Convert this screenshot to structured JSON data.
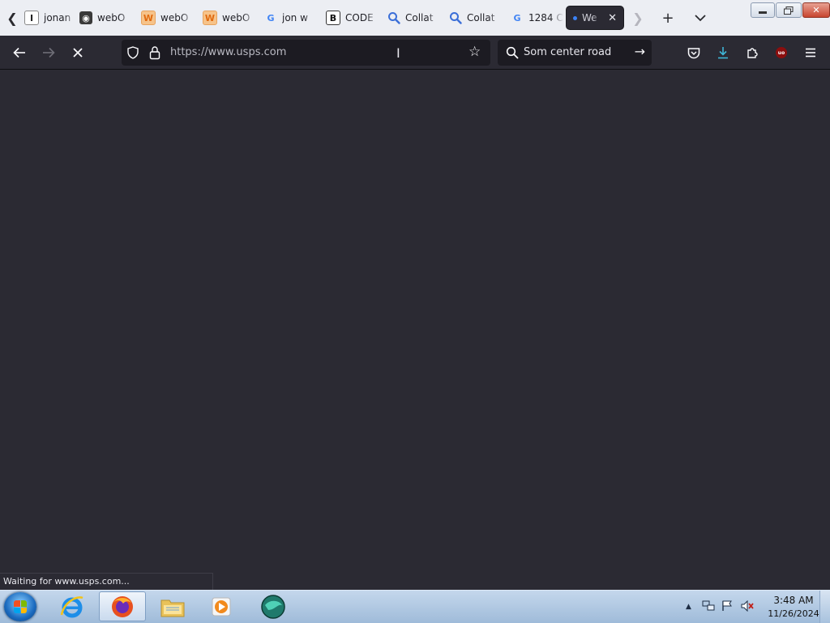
{
  "tabs": [
    {
      "label": "jonan",
      "favicon": "document-icon"
    },
    {
      "label": "webO",
      "favicon": "globe-icon"
    },
    {
      "label": "webO",
      "favicon": "orange-page-icon"
    },
    {
      "label": "webO",
      "favicon": "orange-page-icon"
    },
    {
      "label": "jon w",
      "favicon": "google-icon"
    },
    {
      "label": "CODE",
      "favicon": "code-icon"
    },
    {
      "label": "Collat",
      "favicon": "magnifier-icon"
    },
    {
      "label": "Collat",
      "favicon": "magnifier-icon"
    },
    {
      "label": "1284 C",
      "favicon": "google-icon"
    },
    {
      "label": "We",
      "favicon": "loading-dot",
      "active": true
    }
  ],
  "favicon_glyphs": {
    "jonan": "I",
    "web": "◉",
    "orange": "W",
    "google": "G",
    "code": "B",
    "collat": "Q"
  },
  "url": "https://www.usps.com",
  "search": {
    "value": "Som center road"
  },
  "status_text": "Waiting for www.usps.com...",
  "clock": {
    "time": "3:48 AM",
    "date": "11/26/2024"
  },
  "ublock_label": "uo",
  "colors": {
    "content_bg": "#2b2a33",
    "toolbar_bg": "#2b2a33",
    "urlbar_bg": "#1c1b22",
    "download_accent": "#3fb7d8",
    "tab_strip_bg": "#eceef3"
  }
}
